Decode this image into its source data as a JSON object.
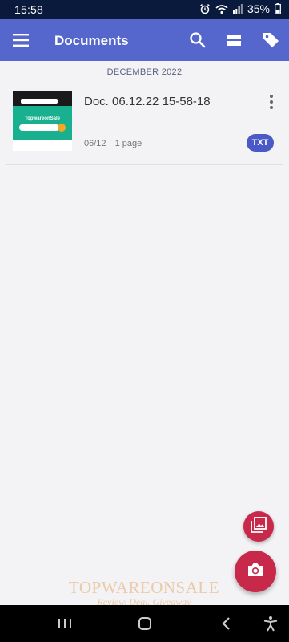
{
  "status_bar": {
    "time": "15:58",
    "battery": "35%",
    "icons": [
      "alarm-icon",
      "wifi-icon",
      "signal-icon"
    ]
  },
  "app_bar": {
    "title": "Documents",
    "actions": [
      "search-icon",
      "view-layout-icon",
      "tag-icon"
    ],
    "color": "#5566cc"
  },
  "section": {
    "label": "DECEMBER 2022"
  },
  "documents": [
    {
      "title": "Doc. 06.12.22 15-58-18",
      "date": "06/12",
      "pages": "1 page",
      "type": "TXT",
      "thumbnail": {
        "title": "TopwareonSale"
      }
    }
  ],
  "fab": {
    "gallery_icon": "gallery-icon",
    "camera_icon": "camera-icon",
    "color": "#c8284a"
  },
  "watermark": {
    "line1": "TOPWAREONSALE",
    "line2": "Review. Deal. Giveaway"
  },
  "nav_bar": {
    "buttons": [
      "recents-icon",
      "home-icon",
      "back-icon",
      "accessibility-icon"
    ]
  }
}
